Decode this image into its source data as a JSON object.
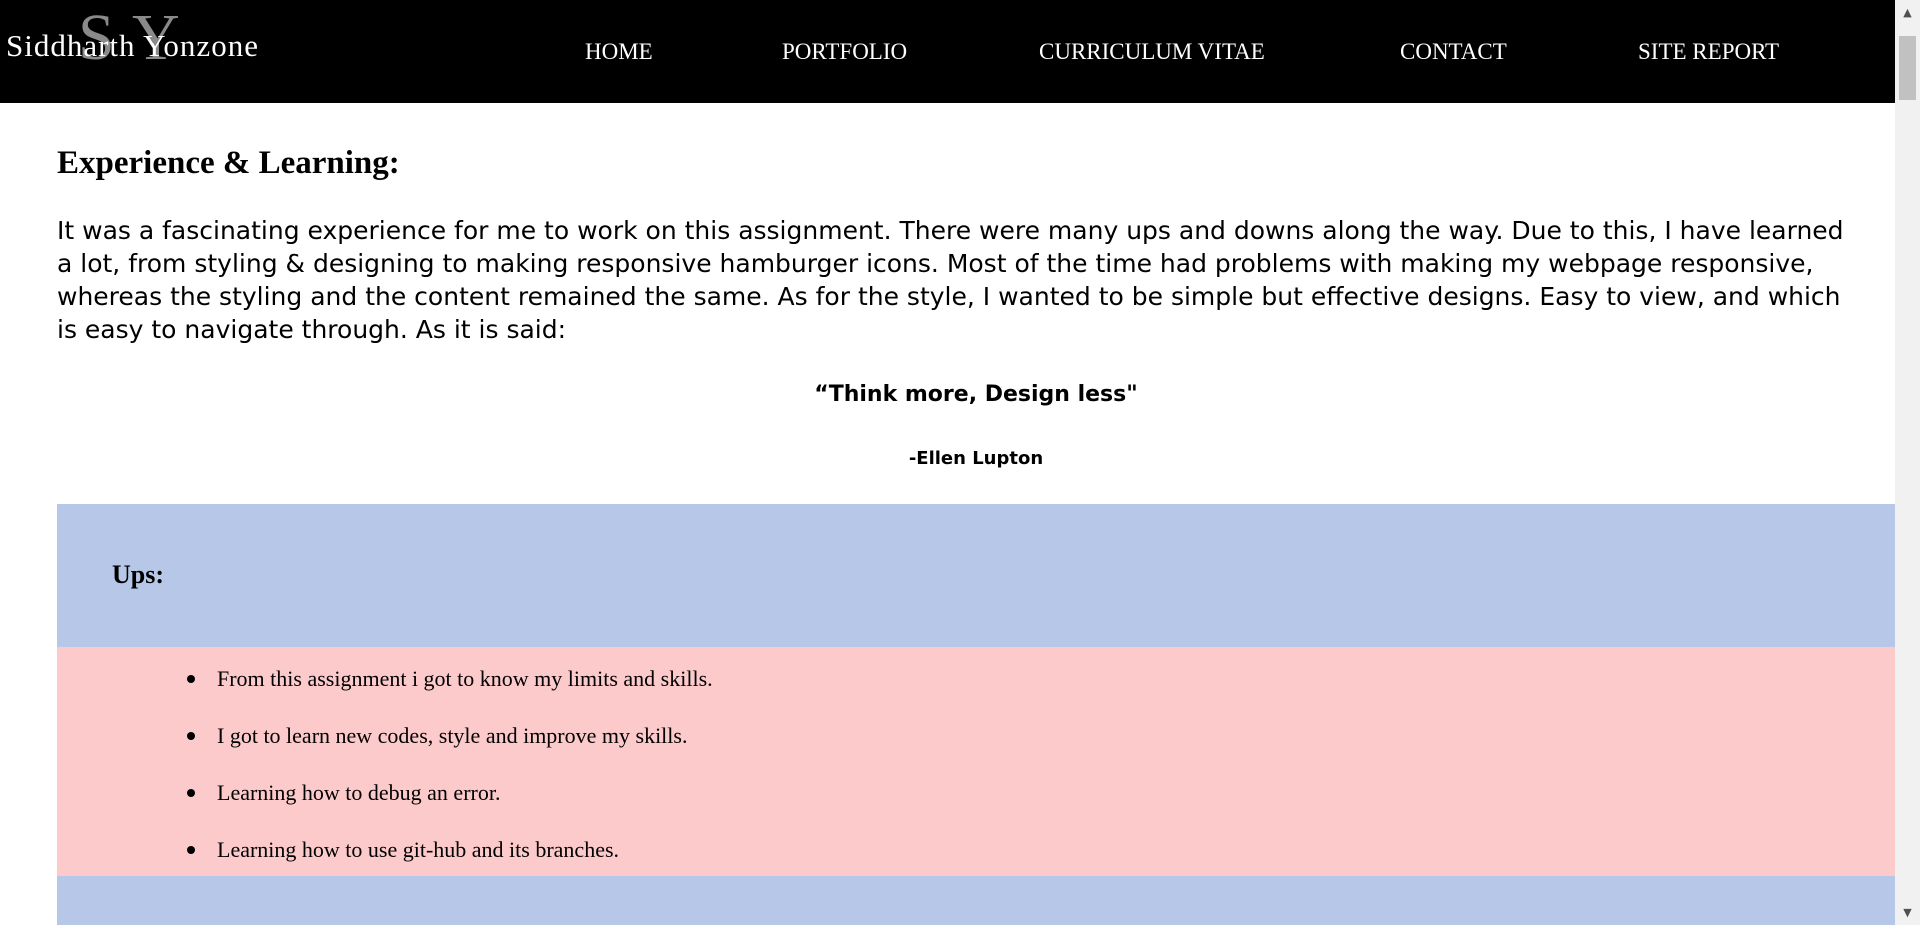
{
  "nav": {
    "logo_monogram_s": "S",
    "logo_monogram_y": "Y",
    "logo_name": "Siddharth Yonzone",
    "items": [
      {
        "label": "HOME"
      },
      {
        "label": "PORTFOLIO"
      },
      {
        "label": "CURRICULUM VITAE"
      },
      {
        "label": "CONTACT"
      },
      {
        "label": "SITE REPORT"
      }
    ]
  },
  "main": {
    "heading": "Experience & Learning:",
    "intro": "It was a fascinating experience for me to work on this assignment. There were many ups and downs along the way. Due to this, I have learned a lot, from styling & designing to making responsive hamburger icons. Most of the time had problems with making my webpage responsive, whereas the styling and the content remained the same. As for the style, I wanted to be simple but effective designs. Easy to view, and which is easy to navigate through. As it is said:",
    "quote": "“Think more, Design less\"",
    "author": "-Ellen Lupton"
  },
  "ups": {
    "title": "Ups:",
    "items": [
      "From this assignment i got to know my limits and skills.",
      "I got to learn new codes, style and improve my skills.",
      "Learning how to debug an error.",
      "Learning how to use git-hub and its branches."
    ]
  },
  "colors": {
    "navbar_bg": "#000000",
    "section_header_bg": "#b6c7e8",
    "list_bg": "#fccacb"
  },
  "scrollbar": {
    "up_icon": "▲",
    "down_icon": "▼"
  }
}
